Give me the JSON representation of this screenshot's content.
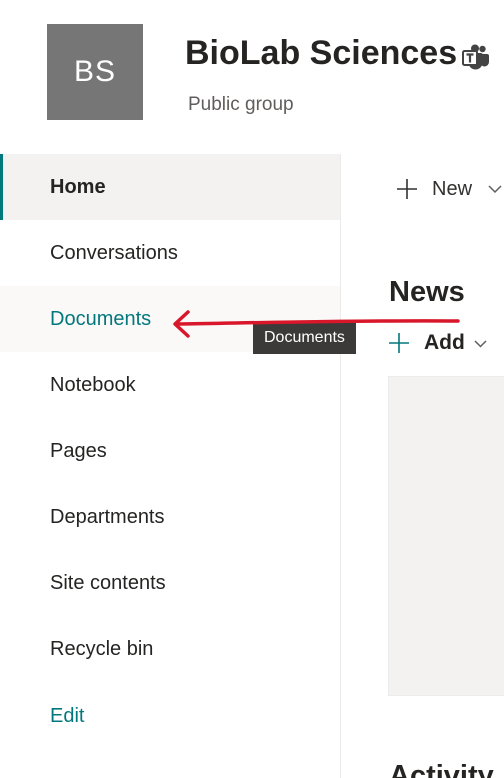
{
  "header": {
    "logo_initials": "BS",
    "site_title": "BioLab Sciences",
    "site_subtitle": "Public group",
    "teams_icon": "teams-icon",
    "logo_color": "#767676"
  },
  "nav": {
    "items": [
      {
        "label": "Home",
        "state": "selected"
      },
      {
        "label": "Conversations",
        "state": "normal"
      },
      {
        "label": "Documents",
        "state": "hovered"
      },
      {
        "label": "Notebook",
        "state": "normal"
      },
      {
        "label": "Pages",
        "state": "normal"
      },
      {
        "label": "Departments",
        "state": "normal"
      },
      {
        "label": "Site contents",
        "state": "normal"
      },
      {
        "label": "Recycle bin",
        "state": "normal"
      }
    ],
    "edit_label": "Edit",
    "accent_color": "#03787c"
  },
  "tooltip": {
    "text": "Documents"
  },
  "annotation": {
    "type": "arrow",
    "color": "#d9172b"
  },
  "command_bar": {
    "new_label": "New"
  },
  "news": {
    "title": "News",
    "add_label": "Add"
  },
  "activity": {
    "title": "Activity"
  }
}
